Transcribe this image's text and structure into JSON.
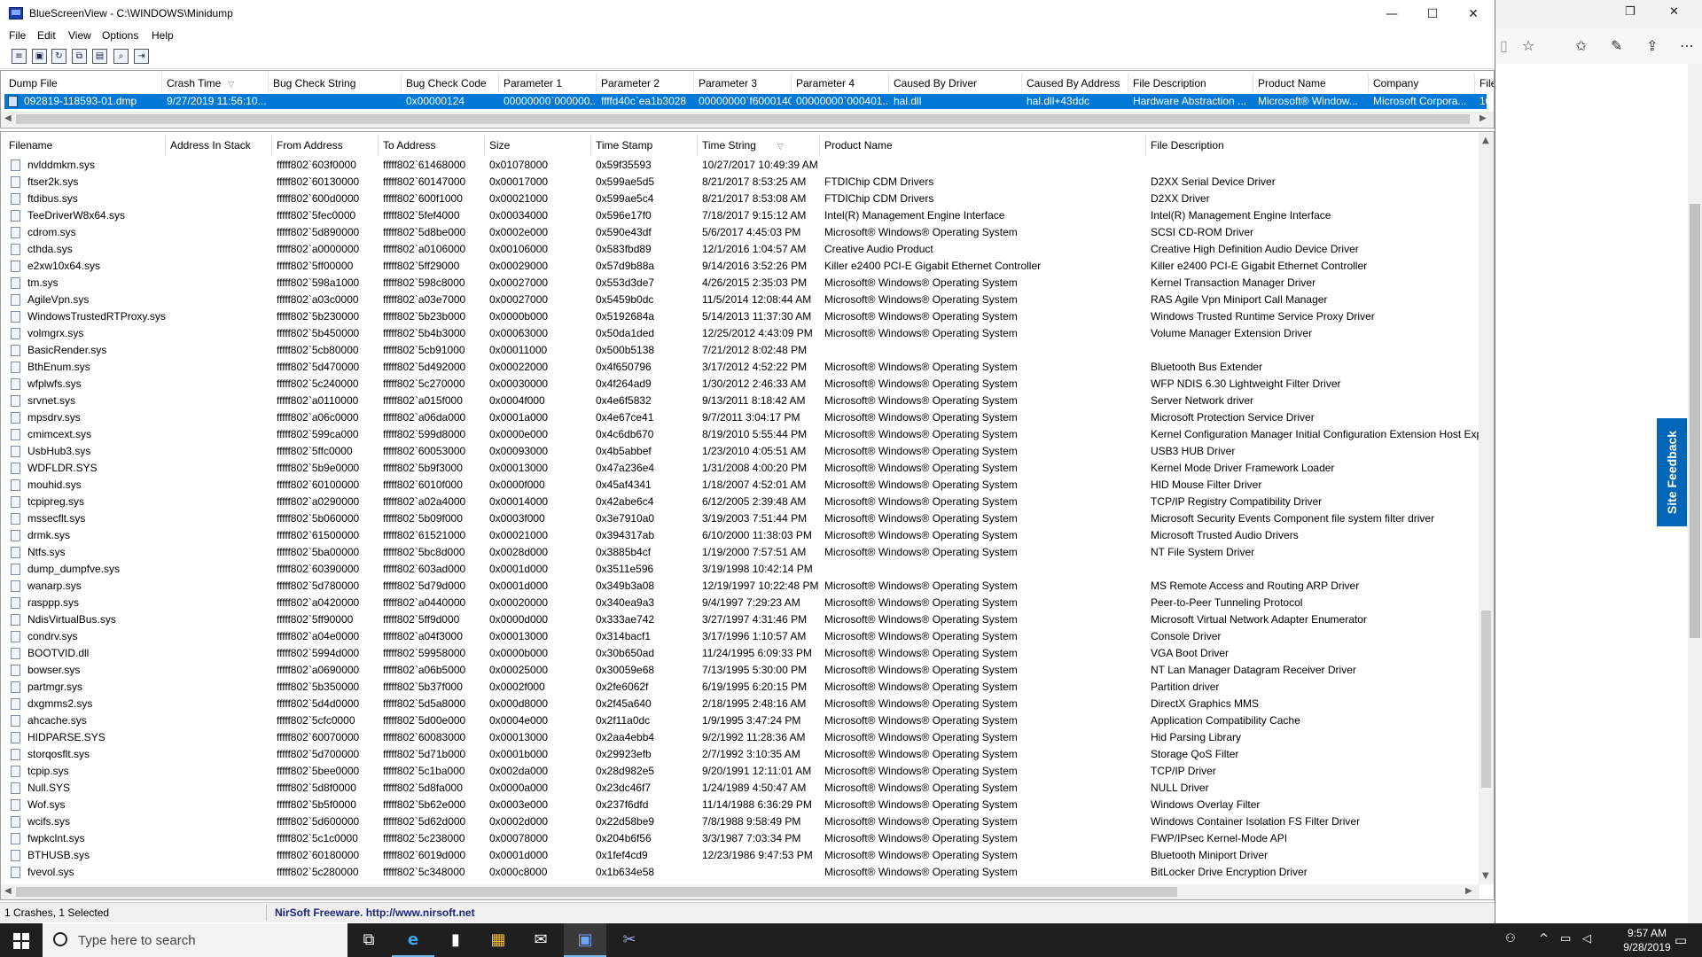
{
  "window": {
    "title": "BlueScreenView  -  C:\\WINDOWS\\Minidump",
    "minimize": "—",
    "maximize": "☐",
    "close": "✕"
  },
  "menu": [
    "File",
    "Edit",
    "View",
    "Options",
    "Help"
  ],
  "toolbar_icons": [
    "properties-icon",
    "save-icon",
    "refresh-icon",
    "copy-icon",
    "html-report-icon",
    "find-icon",
    "exit-icon"
  ],
  "top_columns": [
    "Dump File",
    "Crash Time",
    "Bug Check String",
    "Bug Check Code",
    "Parameter 1",
    "Parameter 2",
    "Parameter 3",
    "Parameter 4",
    "Caused By Driver",
    "Caused By Address",
    "File Description",
    "Product Name",
    "Company",
    "File"
  ],
  "crash_row": [
    "092819-118593-01.dmp",
    "9/27/2019 11:56:10...",
    "",
    "0x00000124",
    "00000000`000000...",
    "ffffd40c`ea1b3028",
    "00000000`f6000140",
    "00000000`000401...",
    "hal.dll",
    "hal.dll+43ddc",
    "Hardware Abstraction ...",
    "Microsoft® Window...",
    "Microsoft Corpora...",
    "10..."
  ],
  "bottom_columns": [
    "Filename",
    "Address In Stack",
    "From Address",
    "To Address",
    "Size",
    "Time Stamp",
    "Time String",
    "Product Name",
    "File Description"
  ],
  "drivers": [
    [
      "nvlddmkm.sys",
      "",
      "fffff802`603f0000",
      "fffff802`61468000",
      "0x01078000",
      "0x59f35593",
      "10/27/2017 10:49:39 AM",
      "",
      ""
    ],
    [
      "ftser2k.sys",
      "",
      "fffff802`60130000",
      "fffff802`60147000",
      "0x00017000",
      "0x599ae5d5",
      "8/21/2017 8:53:25 AM",
      "FTDIChip CDM Drivers",
      "D2XX Serial Device Driver"
    ],
    [
      "ftdibus.sys",
      "",
      "fffff802`600d0000",
      "fffff802`600f1000",
      "0x00021000",
      "0x599ae5c4",
      "8/21/2017 8:53:08 AM",
      "FTDIChip CDM Drivers",
      "D2XX Driver"
    ],
    [
      "TeeDriverW8x64.sys",
      "",
      "fffff802`5fec0000",
      "fffff802`5fef4000",
      "0x00034000",
      "0x596e17f0",
      "7/18/2017 9:15:12 AM",
      "Intel(R) Management Engine Interface",
      "Intel(R) Management Engine Interface"
    ],
    [
      "cdrom.sys",
      "",
      "fffff802`5d890000",
      "fffff802`5d8be000",
      "0x0002e000",
      "0x590e43df",
      "5/6/2017 4:45:03 PM",
      "Microsoft® Windows® Operating System",
      "SCSI CD-ROM Driver"
    ],
    [
      "cthda.sys",
      "",
      "fffff802`a0000000",
      "fffff802`a0106000",
      "0x00106000",
      "0x583fbd89",
      "12/1/2016 1:04:57 AM",
      "Creative Audio Product",
      "Creative High Definition Audio Device Driver"
    ],
    [
      "e2xw10x64.sys",
      "",
      "fffff802`5ff00000",
      "fffff802`5ff29000",
      "0x00029000",
      "0x57d9b88a",
      "9/14/2016 3:52:26 PM",
      "Killer e2400 PCI-E Gigabit Ethernet Controller",
      "Killer e2400 PCI-E Gigabit Ethernet Controller"
    ],
    [
      "tm.sys",
      "",
      "fffff802`598a1000",
      "fffff802`598c8000",
      "0x00027000",
      "0x553d3de7",
      "4/26/2015 2:35:03 PM",
      "Microsoft® Windows® Operating System",
      "Kernel Transaction Manager Driver"
    ],
    [
      "AgileVpn.sys",
      "",
      "fffff802`a03c0000",
      "fffff802`a03e7000",
      "0x00027000",
      "0x5459b0dc",
      "11/5/2014 12:08:44 AM",
      "Microsoft® Windows® Operating System",
      "RAS Agile Vpn Miniport Call Manager"
    ],
    [
      "WindowsTrustedRTProxy.sys",
      "",
      "fffff802`5b230000",
      "fffff802`5b23b000",
      "0x0000b000",
      "0x5192684a",
      "5/14/2013 11:37:30 AM",
      "Microsoft® Windows® Operating System",
      "Windows Trusted Runtime Service Proxy Driver"
    ],
    [
      "volmgrx.sys",
      "",
      "fffff802`5b450000",
      "fffff802`5b4b3000",
      "0x00063000",
      "0x50da1ded",
      "12/25/2012 4:43:09 PM",
      "Microsoft® Windows® Operating System",
      "Volume Manager Extension Driver"
    ],
    [
      "BasicRender.sys",
      "",
      "fffff802`5cb80000",
      "fffff802`5cb91000",
      "0x00011000",
      "0x500b5138",
      "7/21/2012 8:02:48 PM",
      "",
      ""
    ],
    [
      "BthEnum.sys",
      "",
      "fffff802`5d470000",
      "fffff802`5d492000",
      "0x00022000",
      "0x4f650796",
      "3/17/2012 4:52:22 PM",
      "Microsoft® Windows® Operating System",
      "Bluetooth Bus Extender"
    ],
    [
      "wfplwfs.sys",
      "",
      "fffff802`5c240000",
      "fffff802`5c270000",
      "0x00030000",
      "0x4f264ad9",
      "1/30/2012 2:46:33 AM",
      "Microsoft® Windows® Operating System",
      "WFP NDIS 6.30 Lightweight Filter Driver"
    ],
    [
      "srvnet.sys",
      "",
      "fffff802`a0110000",
      "fffff802`a015f000",
      "0x0004f000",
      "0x4e6f5832",
      "9/13/2011 8:18:42 AM",
      "Microsoft® Windows® Operating System",
      "Server Network driver"
    ],
    [
      "mpsdrv.sys",
      "",
      "fffff802`a06c0000",
      "fffff802`a06da000",
      "0x0001a000",
      "0x4e67ce41",
      "9/7/2011 3:04:17 PM",
      "Microsoft® Windows® Operating System",
      "Microsoft Protection Service Driver"
    ],
    [
      "cmimcext.sys",
      "",
      "fffff802`599ca000",
      "fffff802`599d8000",
      "0x0000e000",
      "0x4c6db670",
      "8/19/2010 5:55:44 PM",
      "Microsoft® Windows® Operating System",
      "Kernel Configuration Manager Initial Configuration Extension Host Expo"
    ],
    [
      "UsbHub3.sys",
      "",
      "fffff802`5ffc0000",
      "fffff802`60053000",
      "0x00093000",
      "0x4b5abbef",
      "1/23/2010 4:05:51 AM",
      "Microsoft® Windows® Operating System",
      "USB3 HUB Driver"
    ],
    [
      "WDFLDR.SYS",
      "",
      "fffff802`5b9e0000",
      "fffff802`5b9f3000",
      "0x00013000",
      "0x47a236e4",
      "1/31/2008 4:00:20 PM",
      "Microsoft® Windows® Operating System",
      "Kernel Mode Driver Framework Loader"
    ],
    [
      "mouhid.sys",
      "",
      "fffff802`60100000",
      "fffff802`6010f000",
      "0x0000f000",
      "0x45af4341",
      "1/18/2007 4:52:01 AM",
      "Microsoft® Windows® Operating System",
      "HID Mouse Filter Driver"
    ],
    [
      "tcpipreg.sys",
      "",
      "fffff802`a0290000",
      "fffff802`a02a4000",
      "0x00014000",
      "0x42abe6c4",
      "6/12/2005 2:39:48 AM",
      "Microsoft® Windows® Operating System",
      "TCP/IP Registry Compatibility Driver"
    ],
    [
      "mssecflt.sys",
      "",
      "fffff802`5b060000",
      "fffff802`5b09f000",
      "0x0003f000",
      "0x3e7910a0",
      "3/19/2003 7:51:44 PM",
      "Microsoft® Windows® Operating System",
      "Microsoft Security Events Component file system filter driver"
    ],
    [
      "drmk.sys",
      "",
      "fffff802`61500000",
      "fffff802`61521000",
      "0x00021000",
      "0x394317ab",
      "6/10/2000 11:38:03 PM",
      "Microsoft® Windows® Operating System",
      "Microsoft Trusted Audio Drivers"
    ],
    [
      "Ntfs.sys",
      "",
      "fffff802`5ba00000",
      "fffff802`5bc8d000",
      "0x0028d000",
      "0x3885b4cf",
      "1/19/2000 7:57:51 AM",
      "Microsoft® Windows® Operating System",
      "NT File System Driver"
    ],
    [
      "dump_dumpfve.sys",
      "",
      "fffff802`60390000",
      "fffff802`603ad000",
      "0x0001d000",
      "0x3511e596",
      "3/19/1998 10:42:14 PM",
      "",
      ""
    ],
    [
      "wanarp.sys",
      "",
      "fffff802`5d780000",
      "fffff802`5d79d000",
      "0x0001d000",
      "0x349b3a08",
      "12/19/1997 10:22:48 PM",
      "Microsoft® Windows® Operating System",
      "MS Remote Access and Routing ARP Driver"
    ],
    [
      "rasppp.sys",
      "",
      "fffff802`a0420000",
      "fffff802`a0440000",
      "0x00020000",
      "0x340ea9a3",
      "9/4/1997 7:29:23 AM",
      "Microsoft® Windows® Operating System",
      "Peer-to-Peer Tunneling Protocol"
    ],
    [
      "NdisVirtualBus.sys",
      "",
      "fffff802`5ff90000",
      "fffff802`5ff9d000",
      "0x0000d000",
      "0x333ae742",
      "3/27/1997 4:31:46 PM",
      "Microsoft® Windows® Operating System",
      "Microsoft Virtual Network Adapter Enumerator"
    ],
    [
      "condrv.sys",
      "",
      "fffff802`a04e0000",
      "fffff802`a04f3000",
      "0x00013000",
      "0x314bacf1",
      "3/17/1996 1:10:57 AM",
      "Microsoft® Windows® Operating System",
      "Console Driver"
    ],
    [
      "BOOTVID.dll",
      "",
      "fffff802`5994d000",
      "fffff802`59958000",
      "0x0000b000",
      "0x30b650ad",
      "11/24/1995 6:09:33 PM",
      "Microsoft® Windows® Operating System",
      "VGA Boot Driver"
    ],
    [
      "bowser.sys",
      "",
      "fffff802`a0690000",
      "fffff802`a06b5000",
      "0x00025000",
      "0x30059e68",
      "7/13/1995 5:30:00 PM",
      "Microsoft® Windows® Operating System",
      "NT Lan Manager Datagram Receiver Driver"
    ],
    [
      "partmgr.sys",
      "",
      "fffff802`5b350000",
      "fffff802`5b37f000",
      "0x0002f000",
      "0x2fe6062f",
      "6/19/1995 6:20:15 PM",
      "Microsoft® Windows® Operating System",
      "Partition driver"
    ],
    [
      "dxgmms2.sys",
      "",
      "fffff802`5d4d0000",
      "fffff802`5d5a8000",
      "0x000d8000",
      "0x2f45a640",
      "2/18/1995 2:48:16 AM",
      "Microsoft® Windows® Operating System",
      "DirectX Graphics MMS"
    ],
    [
      "ahcache.sys",
      "",
      "fffff802`5cfc0000",
      "fffff802`5d00e000",
      "0x0004e000",
      "0x2f11a0dc",
      "1/9/1995 3:47:24 PM",
      "Microsoft® Windows® Operating System",
      "Application Compatibility Cache"
    ],
    [
      "HIDPARSE.SYS",
      "",
      "fffff802`60070000",
      "fffff802`60083000",
      "0x00013000",
      "0x2aa4ebb4",
      "9/2/1992 11:28:36 AM",
      "Microsoft® Windows® Operating System",
      "Hid Parsing Library"
    ],
    [
      "storqosflt.sys",
      "",
      "fffff802`5d700000",
      "fffff802`5d71b000",
      "0x0001b000",
      "0x29923efb",
      "2/7/1992 3:10:35 AM",
      "Microsoft® Windows® Operating System",
      "Storage QoS Filter"
    ],
    [
      "tcpip.sys",
      "",
      "fffff802`5bee0000",
      "fffff802`5c1ba000",
      "0x002da000",
      "0x28d982e5",
      "9/20/1991 12:11:01 AM",
      "Microsoft® Windows® Operating System",
      "TCP/IP Driver"
    ],
    [
      "Null.SYS",
      "",
      "fffff802`5d8f0000",
      "fffff802`5d8fa000",
      "0x0000a000",
      "0x23dc46f7",
      "1/24/1989 4:50:47 AM",
      "Microsoft® Windows® Operating System",
      "NULL Driver"
    ],
    [
      "Wof.sys",
      "",
      "fffff802`5b5f0000",
      "fffff802`5b62e000",
      "0x0003e000",
      "0x237f6dfd",
      "11/14/1988 6:36:29 PM",
      "Microsoft® Windows® Operating System",
      "Windows Overlay Filter"
    ],
    [
      "wcifs.sys",
      "",
      "fffff802`5d600000",
      "fffff802`5d62d000",
      "0x0002d000",
      "0x22d58be9",
      "7/8/1988 9:58:49 PM",
      "Microsoft® Windows® Operating System",
      "Windows Container Isolation FS Filter Driver"
    ],
    [
      "fwpkclnt.sys",
      "",
      "fffff802`5c1c0000",
      "fffff802`5c238000",
      "0x00078000",
      "0x204b6f56",
      "3/3/1987 7:03:34 PM",
      "Microsoft® Windows® Operating System",
      "FWP/IPsec Kernel-Mode API"
    ],
    [
      "BTHUSB.sys",
      "",
      "fffff802`60180000",
      "fffff802`6019d000",
      "0x0001d000",
      "0x1fef4cd9",
      "12/23/1986 9:47:53 PM",
      "Microsoft® Windows® Operating System",
      "Bluetooth Miniport Driver"
    ],
    [
      "fvevol.sys",
      "",
      "fffff802`5c280000",
      "fffff802`5c348000",
      "0x000c8000",
      "0x1b634e58",
      "",
      "Microsoft® Windows® Operating System",
      "BitLocker Drive Encryption Driver"
    ]
  ],
  "status": {
    "left": "1 Crashes, 1 Selected",
    "link": "NirSoft Freeware.  http://www.nirsoft.net"
  },
  "background_window": {
    "feedback_label": "Site Feedback"
  },
  "taskbar": {
    "search_placeholder": "Type here to search",
    "time": "9:57 AM",
    "date": "9/28/2019"
  }
}
